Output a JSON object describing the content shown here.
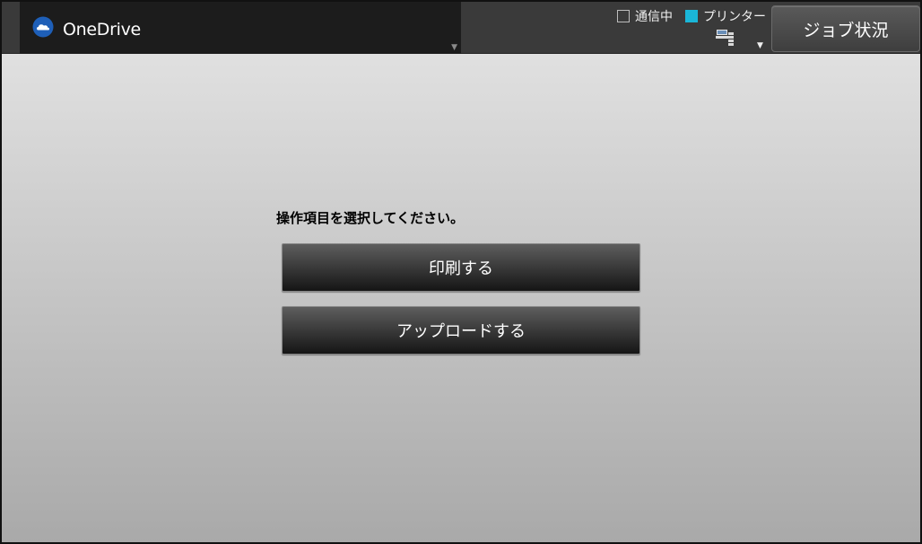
{
  "header": {
    "app_title": "OneDrive",
    "app_icon": "onedrive-cloud-icon",
    "dropdown_glyph": "▼",
    "status": {
      "communicating_label": "通信中",
      "communicating_checked": false,
      "printer_label": "プリンター",
      "printer_checked": true,
      "printer_color": "#1ab6d8",
      "device_icon": "printer-device-icon",
      "dropdown_glyph": "▼"
    },
    "job_status_label": "ジョブ状況"
  },
  "main": {
    "instruction": "操作項目を選択してください。",
    "actions": [
      {
        "label": "印刷する"
      },
      {
        "label": "アップロードする"
      }
    ]
  }
}
